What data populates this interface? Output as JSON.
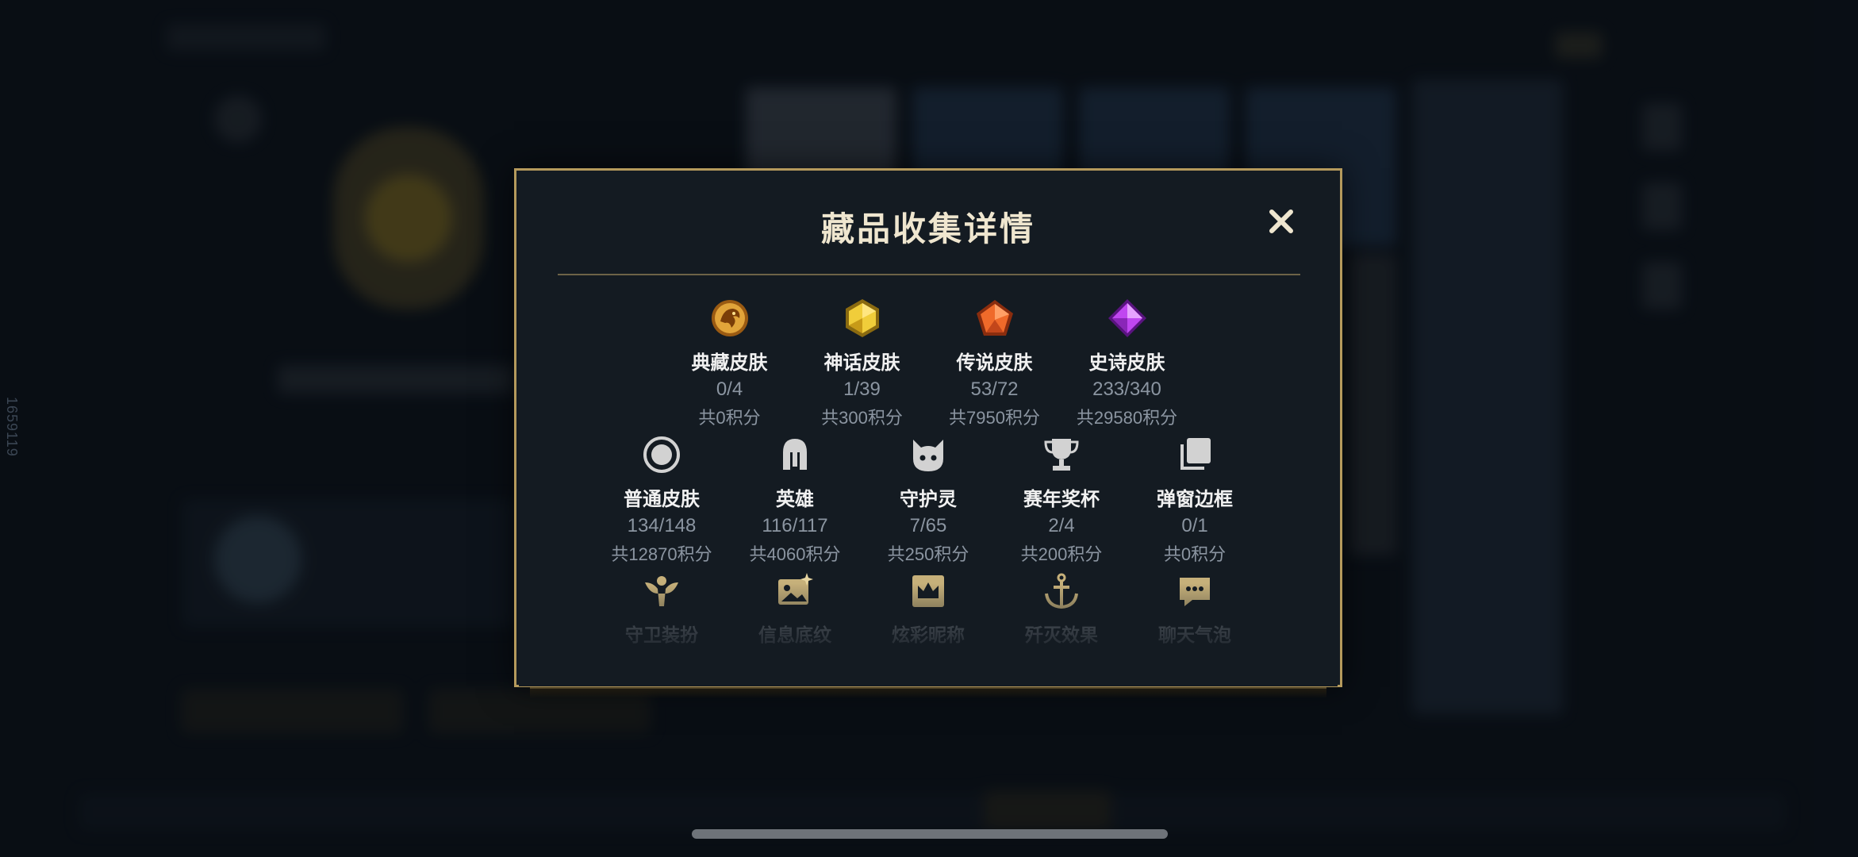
{
  "modal": {
    "title": "藏品收集详情",
    "close_icon": "close-icon"
  },
  "background": {
    "side_id": "1659119"
  },
  "collections": [
    {
      "name": "典藏皮肤",
      "count": "0/4",
      "points": "共0积分",
      "icon": "dragon-medal-icon",
      "color": "#d9a23a"
    },
    {
      "name": "神话皮肤",
      "count": "1/39",
      "points": "共300积分",
      "icon": "gold-hexagon-gem-icon",
      "color": "#e6c43a"
    },
    {
      "name": "传说皮肤",
      "count": "53/72",
      "points": "共7950积分",
      "icon": "orange-pentagon-gem-icon",
      "color": "#e4622a"
    },
    {
      "name": "史诗皮肤",
      "count": "233/340",
      "points": "共29580积分",
      "icon": "purple-diamond-gem-icon",
      "color": "#b53be0"
    },
    {
      "name": "普通皮肤",
      "count": "134/148",
      "points": "共12870积分",
      "icon": "circle-ring-icon",
      "color": "#c9c9c9"
    },
    {
      "name": "英雄",
      "count": "116/117",
      "points": "共4060积分",
      "icon": "helmet-icon",
      "color": "#c9c9c9"
    },
    {
      "name": "守护灵",
      "count": "7/65",
      "points": "共250积分",
      "icon": "guardian-spirit-icon",
      "color": "#c9c9c9"
    },
    {
      "name": "赛年奖杯",
      "count": "2/4",
      "points": "共200积分",
      "icon": "trophy-icon",
      "color": "#c9c9c9"
    },
    {
      "name": "弹窗边框",
      "count": "0/1",
      "points": "共0积分",
      "icon": "stacked-frames-icon",
      "color": "#c9c9c9"
    },
    {
      "name": "守卫装扮",
      "icon": "guardian-outfit-icon",
      "color": "#b59a5c"
    },
    {
      "name": "信息底纹",
      "icon": "image-sparkle-icon",
      "color": "#b59a5c"
    },
    {
      "name": "炫彩昵称",
      "icon": "crown-card-icon",
      "color": "#b59a5c"
    },
    {
      "name": "歼灭效果",
      "icon": "anchor-icon",
      "color": "#b59a5c"
    },
    {
      "name": "聊天气泡",
      "icon": "chat-bubble-icon",
      "color": "#b59a5c"
    }
  ],
  "colors": {
    "accent_gold": "#b59a5c",
    "modal_bg": "#141b22",
    "page_bg": "#0b1119"
  }
}
